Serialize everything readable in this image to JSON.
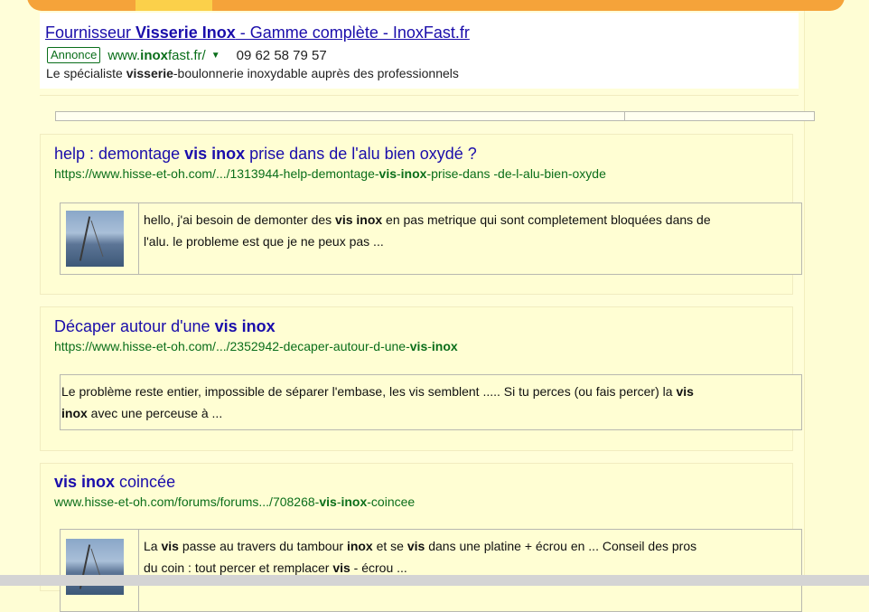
{
  "ad": {
    "title_parts": [
      "Fournisseur ",
      "Visserie Inox",
      " - Gamme complète - InoxFast.fr"
    ],
    "badge": "Annonce",
    "url_parts": [
      "www.",
      "inox",
      "fast.fr/"
    ],
    "dropdown_icon": "triangle-down-icon",
    "phone": "09 62 58 79 57",
    "desc_parts": [
      "Le spécialiste ",
      "visserie",
      "-boulonnerie inoxydable auprès des professionnels"
    ]
  },
  "results": [
    {
      "title_parts": [
        "help : demontage ",
        "vis inox",
        " prise dans de l'alu bien oxydé ?"
      ],
      "url_parts": [
        "https://www.hisse-et-oh.com/.../1313944-help-demontage-",
        "vis",
        "-",
        "inox",
        "-prise-dans -de-l-alu-bien-oxyde"
      ],
      "snippet_line1": [
        "hello, j'ai besoin de demonter des ",
        "vis inox",
        " en pas metrique qui sont completement bloquées dans de"
      ],
      "snippet_line2": "l'alu. le probleme est que je ne peux pas ..."
    },
    {
      "title_parts": [
        "Décaper autour d'une ",
        "vis inox"
      ],
      "url_parts": [
        "https://www.hisse-et-oh.com/.../2352942-decaper-autour-d-une-",
        "vis",
        "-",
        "inox"
      ],
      "snippet_line1": [
        "Le problème reste entier, impossible de séparer l'embase, les vis semblent ..... Si tu perces (ou fais percer) la ",
        "vis"
      ],
      "snippet_line2_parts": [
        "inox",
        " avec une perceuse à ..."
      ]
    },
    {
      "title_parts": [
        "vis inox",
        " coincée"
      ],
      "url_parts": [
        "www.hisse-et-oh.com/forums/forums.../708268-",
        "vis",
        "-",
        "inox",
        "-coincee"
      ],
      "snippet_line1": [
        "La ",
        "vis",
        " passe au travers du tambour ",
        "inox",
        " et se ",
        "vis",
        " dans une platine + écrou en ... Conseil des pros"
      ],
      "snippet_line2_parts": [
        "du coin : tout percer et remplacer ",
        "vis",
        " - écrou ..."
      ]
    }
  ]
}
